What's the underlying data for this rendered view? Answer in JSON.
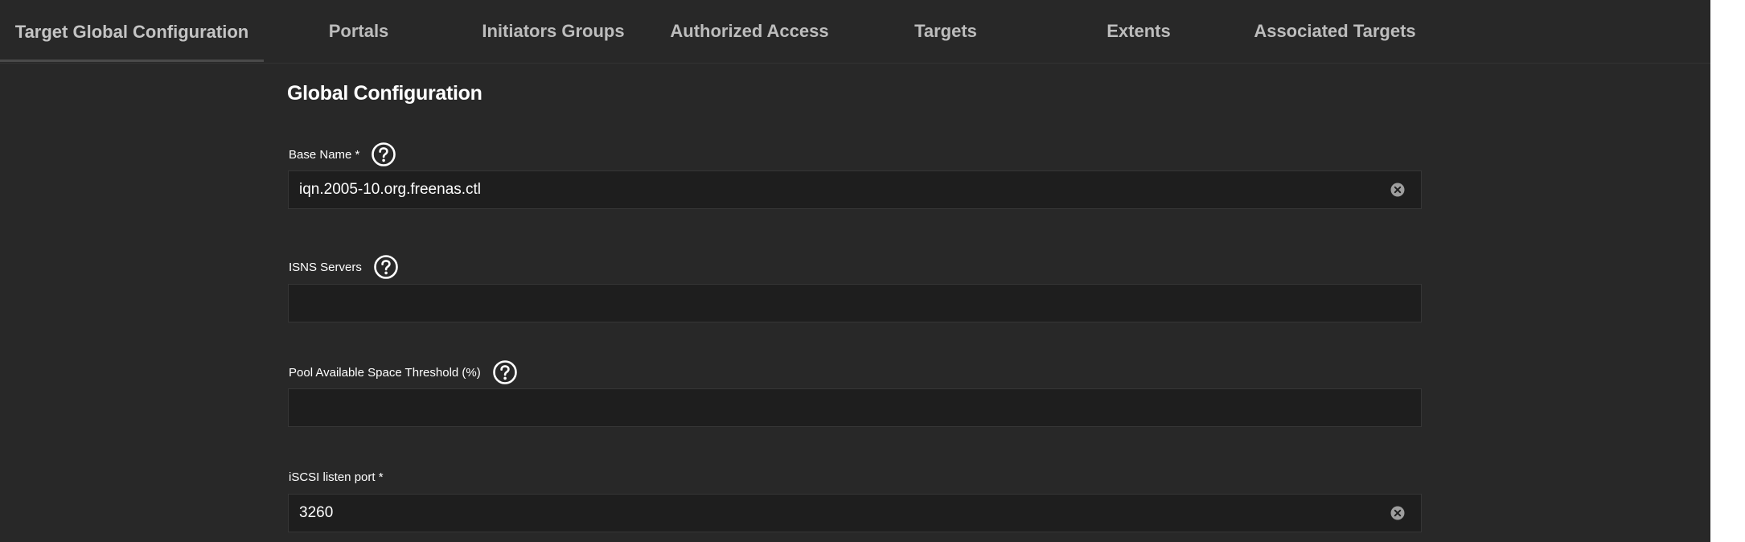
{
  "tabs": [
    {
      "label": "Target Global Configuration",
      "active": true
    },
    {
      "label": "Portals",
      "active": false
    },
    {
      "label": "Initiators Groups",
      "active": false
    },
    {
      "label": "Authorized Access",
      "active": false
    },
    {
      "label": "Targets",
      "active": false
    },
    {
      "label": "Extents",
      "active": false
    },
    {
      "label": "Associated Targets",
      "active": false
    }
  ],
  "form": {
    "title": "Global Configuration",
    "base_name": {
      "label": "Base Name *",
      "value": "iqn.2005-10.org.freenas.ctl",
      "placeholder": ""
    },
    "isns_servers": {
      "label": "ISNS Servers",
      "value": "",
      "placeholder": ""
    },
    "pool_threshold": {
      "label": "Pool Available Space Threshold (%)",
      "value": "",
      "placeholder": ""
    },
    "listen_port": {
      "label": "iSCSI listen port *",
      "value": "3260",
      "placeholder": ""
    }
  },
  "icons": {
    "help": "help-circle-icon",
    "clear": "clear-circle-icon"
  },
  "colors": {
    "background": "#282828",
    "input_background": "#1e1e1e",
    "text": "#ffffff",
    "tab_text": "#bdbdbd"
  }
}
